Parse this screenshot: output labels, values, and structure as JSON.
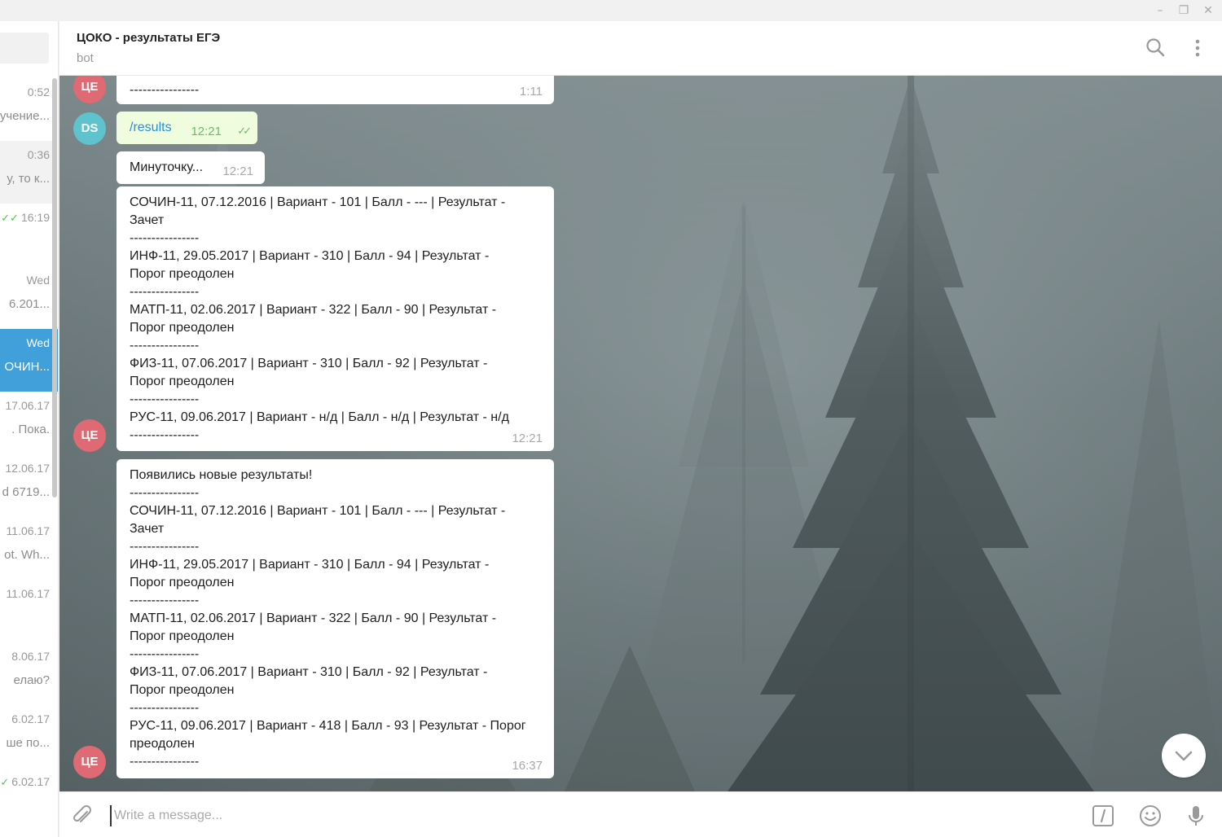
{
  "window": {
    "minimize": "–",
    "restore": "❐",
    "close": "✕"
  },
  "sidebar": {
    "dialogs": [
      {
        "time": "0:52",
        "preview": "учение..."
      },
      {
        "time": "0:36",
        "preview": "у, то к..."
      },
      {
        "time": "16:19",
        "preview": "",
        "check": "✓✓"
      },
      {
        "time": "Wed",
        "preview": "6.201..."
      },
      {
        "time": "Wed",
        "preview": "ОЧИН..."
      },
      {
        "time": "17.06.17",
        "preview": ". Пока."
      },
      {
        "time": "12.06.17",
        "preview": "d 6719..."
      },
      {
        "time": "11.06.17",
        "preview": "ot. Wh..."
      },
      {
        "time": "11.06.17",
        "preview": ""
      },
      {
        "time": "8.06.17",
        "preview": "елаю?"
      },
      {
        "time": "6.02.17",
        "preview": "ше по..."
      },
      {
        "time": "6.02.17",
        "preview": "",
        "check": "✓"
      }
    ]
  },
  "header": {
    "title": "ЦОКО - результаты ЕГЭ",
    "subtitle": "bot"
  },
  "messages": [
    {
      "id": "m1",
      "avatar": "ЦЕ",
      "lines": [
        "----------------"
      ],
      "time": "1:11"
    },
    {
      "id": "m2",
      "avatar": "DS",
      "text": "/results",
      "time": "12:21",
      "status": "✓✓"
    },
    {
      "id": "m3",
      "text": "Минуточку...",
      "time": "12:21"
    },
    {
      "id": "m4",
      "avatar": "ЦЕ",
      "lines": [
        "СОЧИН-11, 07.12.2016 | Вариант - 101 | Балл - --- | Результат -",
        "Зачет",
        "----------------",
        "ИНФ-11, 29.05.2017 | Вариант - 310 | Балл - 94 | Результат -",
        "Порог преодолен",
        "----------------",
        "МАТП-11, 02.06.2017 | Вариант - 322 | Балл - 90 | Результат -",
        "Порог преодолен",
        "----------------",
        "ФИЗ-11, 07.06.2017 | Вариант - 310 | Балл - 92 | Результат -",
        "Порог преодолен",
        "----------------",
        "РУС-11, 09.06.2017 | Вариант - н/д | Балл - н/д | Результат - н/д",
        "----------------"
      ],
      "time": "12:21"
    },
    {
      "id": "m5",
      "avatar": "ЦЕ",
      "lines": [
        "Появились новые результаты!",
        "----------------",
        "СОЧИН-11, 07.12.2016 | Вариант - 101 | Балл - --- | Результат -",
        "Зачет",
        "----------------",
        "ИНФ-11, 29.05.2017 | Вариант - 310 | Балл - 94 | Результат -",
        "Порог преодолен",
        "----------------",
        "МАТП-11, 02.06.2017 | Вариант - 322 | Балл - 90 | Результат -",
        "Порог преодолен",
        "----------------",
        "ФИЗ-11, 07.06.2017 | Вариант - 310 | Балл - 92 | Результат -",
        "Порог преодолен",
        "----------------",
        "РУС-11, 09.06.2017 | Вариант - 418 | Балл - 93 | Результат - Порог",
        "преодолен",
        "----------------"
      ],
      "time": "16:37"
    }
  ],
  "compose": {
    "placeholder": "Write a message..."
  },
  "colors": {
    "accent": "#419fd9",
    "avatar_ce": "#e06a73",
    "avatar_ds": "#5fc3cd",
    "outgoing_bubble": "#effdde",
    "check": "#4dc84a"
  },
  "icons": [
    "search-icon",
    "more-icon",
    "attach-icon",
    "bot-command-icon",
    "emoji-icon",
    "microphone-icon",
    "chevron-down-icon"
  ]
}
